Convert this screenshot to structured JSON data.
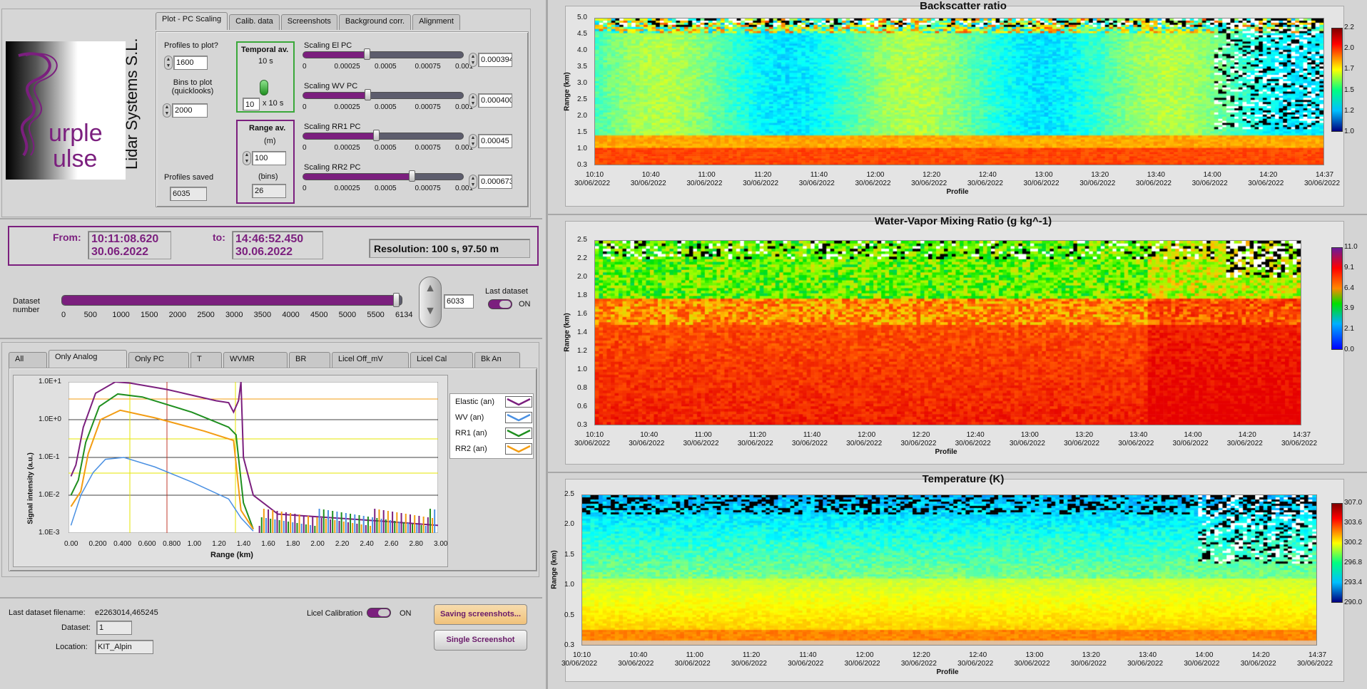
{
  "logo": {
    "line1": "urple",
    "line2": "ulse",
    "vertical": "Lidar Systems S.L."
  },
  "tabs_top": [
    "Plot - PC Scaling",
    "Calib. data",
    "Screenshots",
    "Background corr.",
    "Alignment"
  ],
  "controls": {
    "profiles_label": "Profiles to plot?",
    "profiles_value": "1600",
    "bins_label": "Bins to plot (quicklooks)",
    "bins_value": "2000",
    "saved_label": "Profiles saved",
    "saved_value": "6035",
    "temporal_title": "Temporal av.",
    "temporal_sub": "10 s",
    "temporal_value": "10",
    "temporal_unit": "x 10 s",
    "range_title": "Range av.",
    "range_unit": "(m)",
    "range_value": "100",
    "range_bins_label": "(bins)",
    "range_bins_value": "26"
  },
  "scalings": [
    {
      "label": "Scaling El PC",
      "value": "0.000394",
      "level": 0.394
    },
    {
      "label": "Scaling WV PC",
      "value": "0.000400",
      "level": 0.4
    },
    {
      "label": "Scaling RR1 PC",
      "value": "0.00045",
      "level": 0.45
    },
    {
      "label": "Scaling RR2 PC",
      "value": "0.000673",
      "level": 0.673
    }
  ],
  "scale_ticks": [
    "0",
    "0.00025",
    "0.0005",
    "0.00075",
    "0.001"
  ],
  "time": {
    "from_label": "From:",
    "from_time": "10:11:08.620",
    "from_date": "30.06.2022",
    "to_label": "to:",
    "to_time": "14:46:52.450",
    "to_date": "30.06.2022",
    "resolution": "Resolution: 100 s, 97.50 m"
  },
  "dataset": {
    "label": "Dataset number",
    "ticks": [
      "0",
      "500",
      "1000",
      "1500",
      "2000",
      "2500",
      "3000",
      "3500",
      "4000",
      "4500",
      "5000",
      "5500",
      "6134"
    ],
    "value": "6033",
    "level": 0.983,
    "last_label": "Last dataset",
    "last_state": "ON"
  },
  "signal_tabs": [
    "All",
    "Only Analog",
    "Only PC",
    "T",
    "WVMR",
    "BR",
    "Licel Off_mV",
    "Licel Cal",
    "Bk An"
  ],
  "signal_plot": {
    "ylabel": "Signal intensity (a.u.)",
    "xlabel": "Range (km)",
    "yticks": [
      "1.0E+1",
      "1.0E+0",
      "1.0E-1",
      "1.0E-2",
      "1.0E-3"
    ],
    "xticks": [
      "0.00",
      "0.200",
      "0.400",
      "0.600",
      "0.800",
      "1.00",
      "1.20",
      "1.40",
      "1.60",
      "1.80",
      "2.00",
      "2.20",
      "2.40",
      "2.60",
      "2.80",
      "3.00"
    ],
    "legend": [
      {
        "name": "Elastic (an)",
        "color": "#7b1f7e"
      },
      {
        "name": "WV (an)",
        "color": "#4a90e2"
      },
      {
        "name": "RR1 (an)",
        "color": "#1f8f1f"
      },
      {
        "name": "RR2 (an)",
        "color": "#f39c12"
      }
    ]
  },
  "bottom": {
    "filename_label": "Last dataset filename:",
    "filename_value": "e2263014,465245",
    "dataset_label": "Dataset:",
    "dataset_value": "1",
    "location_label": "Location:",
    "location_value": "KIT_Alpin",
    "licel_label": "Licel Calibration",
    "licel_state": "ON",
    "save_btn": "Saving screenshots...",
    "single_btn": "Single Screenshot"
  },
  "time_ticks": [
    "10:10",
    "10:40",
    "11:00",
    "11:20",
    "11:40",
    "12:00",
    "12:20",
    "12:40",
    "13:00",
    "13:20",
    "13:40",
    "14:00",
    "14:20",
    "14:37"
  ],
  "time_date": "30/06/2022",
  "xlabel_profile": "Profile",
  "ylabel_range": "Range (km)",
  "plots": [
    {
      "title": "Backscatter ratio",
      "yticks": [
        "5.0",
        "4.5",
        "4.0",
        "3.5",
        "3.0",
        "2.5",
        "2.0",
        "1.5",
        "1.0",
        "0.3"
      ],
      "cbar": [
        "2.2",
        "2.0",
        "1.7",
        "1.5",
        "1.2",
        "1.0"
      ]
    },
    {
      "title": "Water-Vapor Mixing Ratio  (g kg^-1)",
      "yticks": [
        "2.5",
        "2.2",
        "2.0",
        "1.8",
        "1.6",
        "1.4",
        "1.2",
        "1.0",
        "0.8",
        "0.6",
        "0.3"
      ],
      "cbar": [
        "11.0",
        "9.1",
        "6.4",
        "3.9",
        "2.1",
        "0.0"
      ]
    },
    {
      "title": "Temperature (K)",
      "yticks": [
        "2.5",
        "2.0",
        "1.5",
        "1.0",
        "0.5",
        "0.3"
      ],
      "cbar": [
        "307.0",
        "303.6",
        "300.2",
        "296.8",
        "293.4",
        "290.0"
      ]
    }
  ]
}
